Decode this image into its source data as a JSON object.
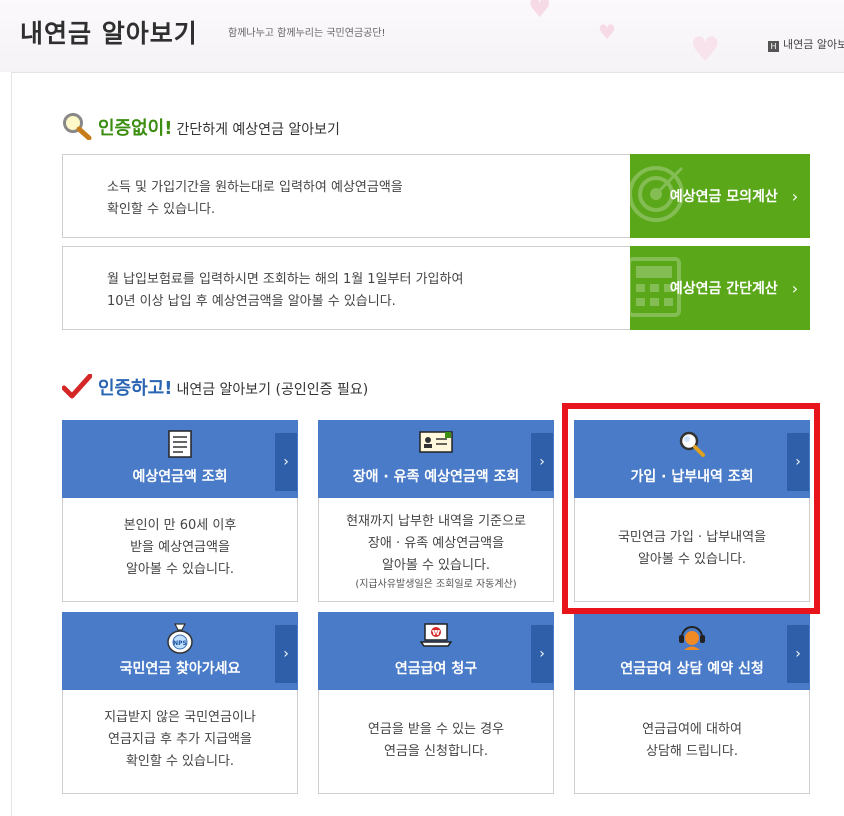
{
  "header": {
    "title": "내연금 알아보기",
    "slogan": "함께나누고 함께누리는 국민연금공단!",
    "breadcrumb": "내연금 알아보",
    "breadcrumb_icon_letter": "H"
  },
  "section_no_cert": {
    "accent": "인증없이!",
    "rest": "간단하게 예상연금 알아보기",
    "items": [
      {
        "desc_line1": "소득 및 가입기간을 원하는대로 입력하여 예상연금액을",
        "desc_line2": "확인할 수 있습니다.",
        "button": "예상연금 모의계산"
      },
      {
        "desc_line1": "월 납입보험료를 입력하시면 조회하는 해의 1월 1일부터 가입하여",
        "desc_line2": "10년 이상 납입 후 예상연금액을 알아볼 수 있습니다.",
        "button": "예상연금 간단계산"
      }
    ]
  },
  "section_cert": {
    "accent": "인증하고!",
    "rest": "내연금 알아보기 (공인인증 필요)"
  },
  "cards": [
    {
      "title": "예상연금액 조회",
      "icon": "document-list-icon",
      "lines": [
        "본인이 만 60세 이후",
        "받을 예상연금액을",
        "알아볼 수 있습니다."
      ]
    },
    {
      "title": "장애 · 유족 예상연금액 조회",
      "icon": "id-card-icon",
      "lines": [
        "현재까지 납부한 내역을 기준으로",
        "장애 · 유족 예상연금액을",
        "알아볼 수 있습니다."
      ],
      "note": "(지급사유발생일은 조회일로 자동계산)"
    },
    {
      "title": "가입 · 납부내역 조회",
      "icon": "magnifier-icon",
      "lines": [
        "국민연금 가입 · 납부내역을",
        "알아볼 수 있습니다."
      ]
    },
    {
      "title": "국민연금 찾아가세요",
      "icon": "nps-pouch-icon",
      "lines": [
        "지급받지 않은 국민연금이나",
        "연금지급 후 추가 지급액을",
        "확인할 수 있습니다."
      ]
    },
    {
      "title": "연금급여 청구",
      "icon": "laptop-won-icon",
      "lines": [
        "연금을 받을 수 있는 경우",
        "연금을 신청합니다."
      ]
    },
    {
      "title": "연금급여 상담 예약 신청",
      "icon": "headset-agent-icon",
      "lines": [
        "연금급여에 대하여",
        "상담해 드립니다."
      ]
    }
  ],
  "colors": {
    "green_accent": "#3b8e11",
    "green_button": "#5aa71a",
    "blue_card": "#4a7bc8",
    "blue_arrow": "#2f5fa8",
    "highlight_red": "#e8141c"
  }
}
